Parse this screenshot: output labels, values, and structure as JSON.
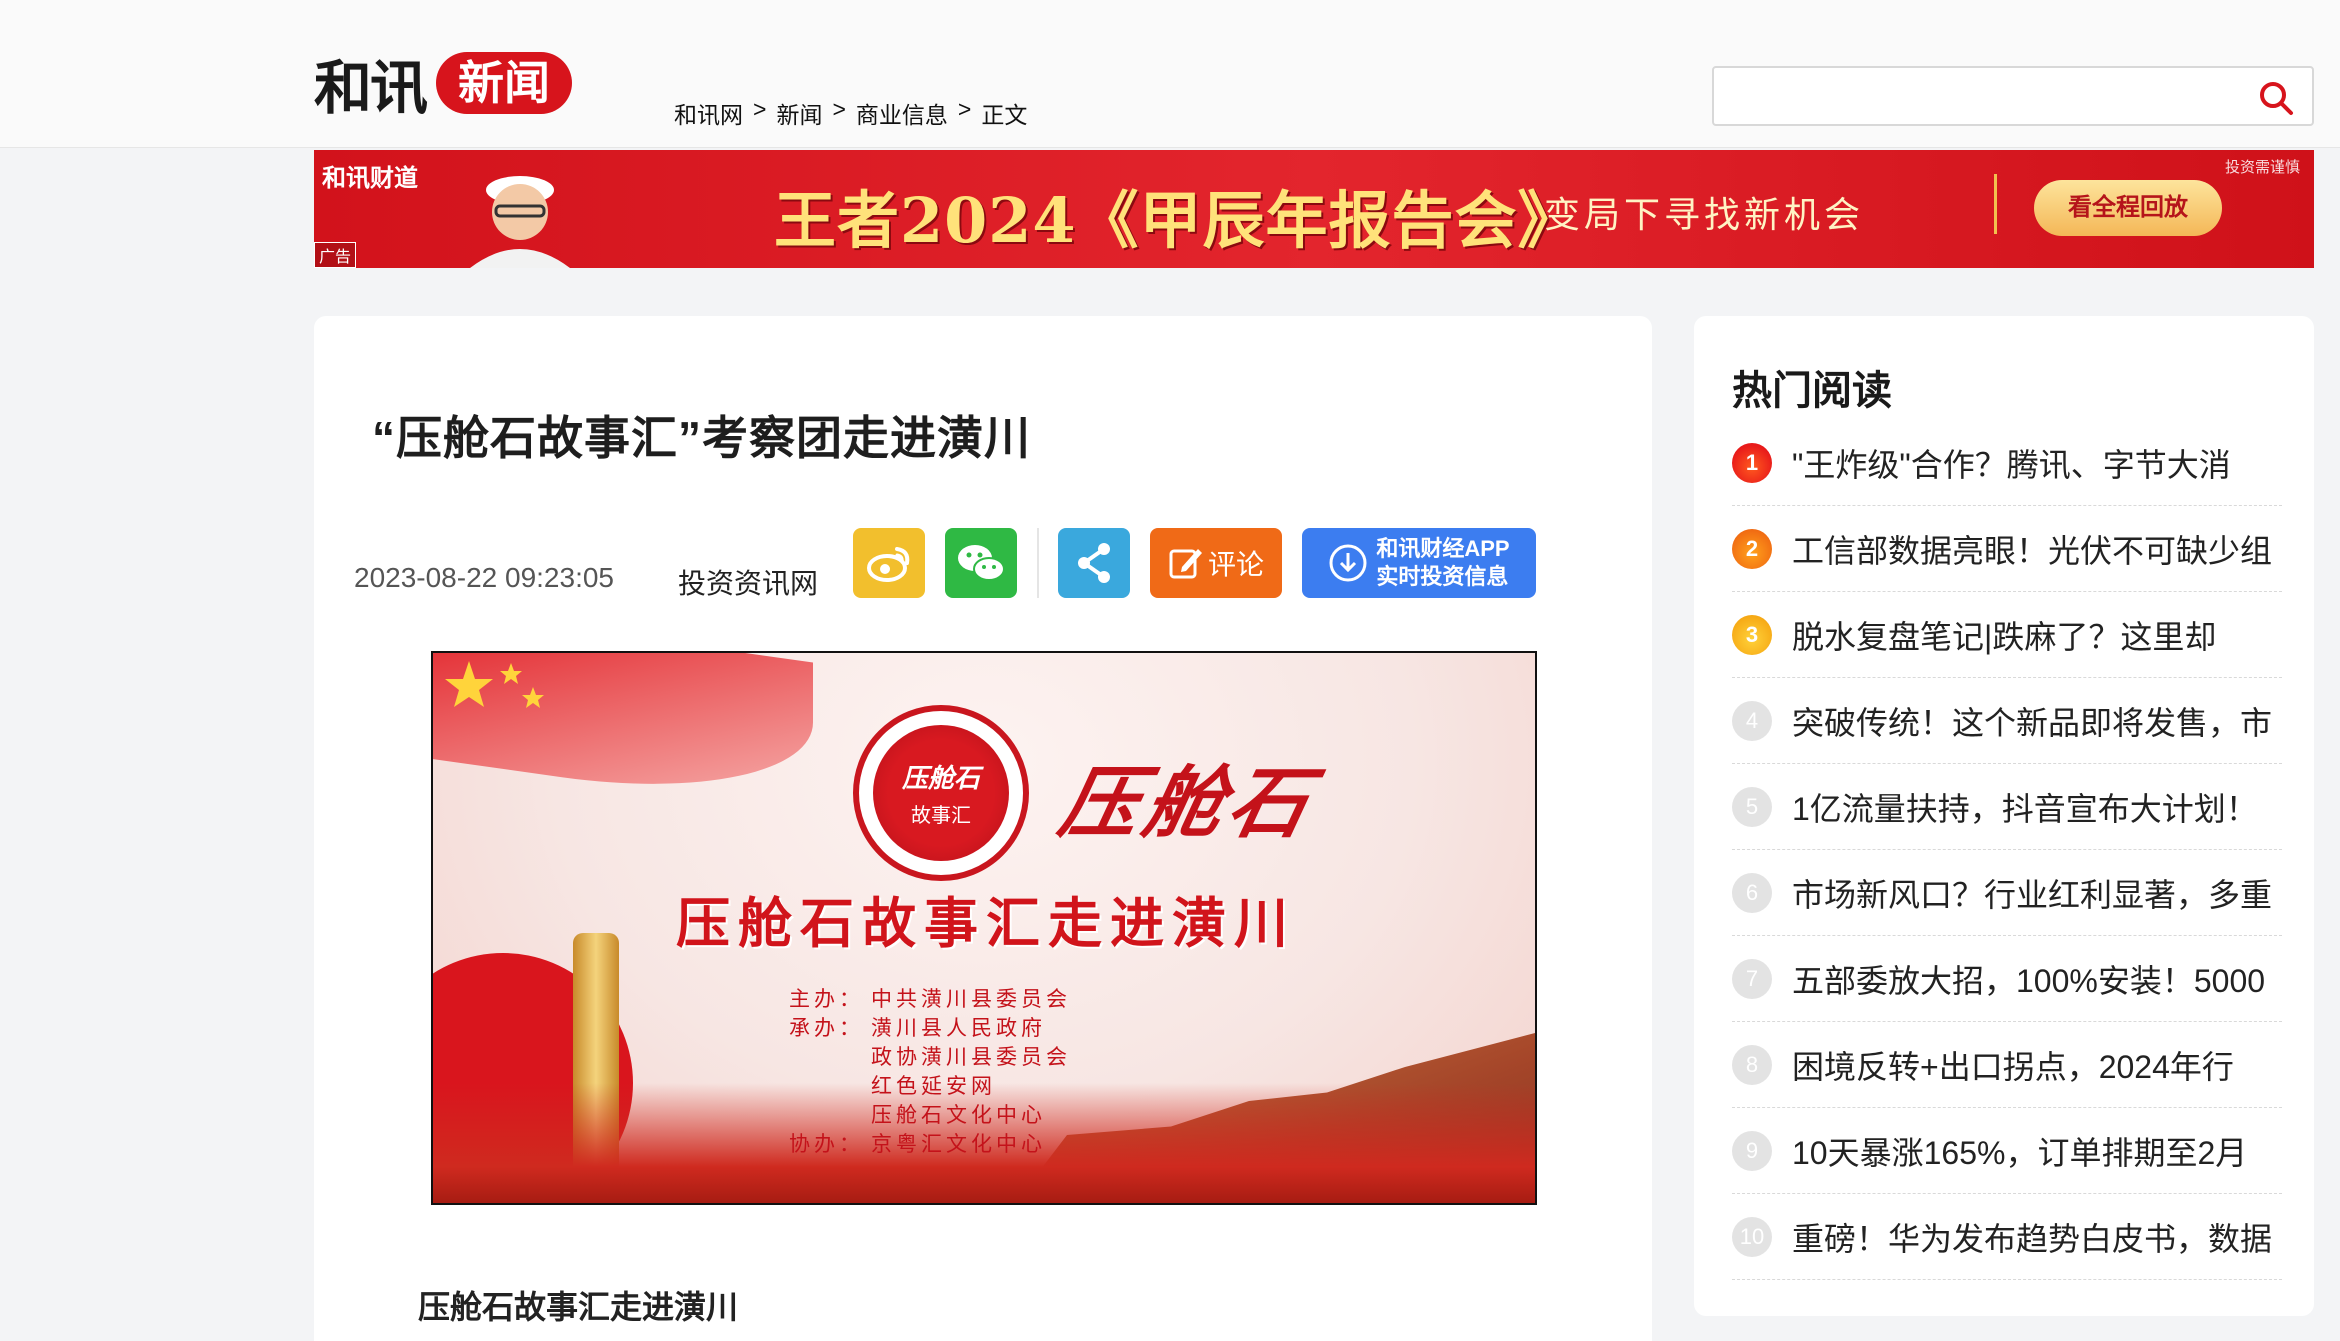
{
  "header": {
    "logo_main": "和讯",
    "logo_section": "新闻",
    "breadcrumb": [
      "和讯网",
      "新闻",
      "商业信息",
      "正文"
    ],
    "breadcrumb_sep": ">",
    "search_placeholder": ""
  },
  "banner": {
    "brand": "和讯财道",
    "ad_label": "广告",
    "title": "王者2024《甲辰年报告会》",
    "subtitle": "变局下寻找新机会",
    "button": "看全程回放",
    "note": "投资需谨慎"
  },
  "article": {
    "title": "“压舱石故事汇”考察团走进潢川",
    "date": "2023-08-22 09:23:05",
    "source": "投资资讯网",
    "share": {
      "comment": "评论",
      "app_line1": "和讯财经APP",
      "app_line2": "实时投资信息"
    },
    "figure": {
      "seal_top": "压舱石",
      "seal_bottom": "故事汇",
      "calligraphy": "压舱石",
      "headline": "压舱石故事汇走进潢川",
      "credits": [
        {
          "k": "主办：",
          "v": "中共潢川县委员会"
        },
        {
          "k": "承办：",
          "v": "潢川县人民政府"
        },
        {
          "k": "",
          "v": "政协潢川县委员会"
        },
        {
          "k": "",
          "v": "红色延安网"
        },
        {
          "k": "",
          "v": "压舱石文化中心"
        },
        {
          "k": "协办：",
          "v": "京粤汇文化中心"
        }
      ]
    },
    "subhead": "压舱石故事汇走进潢川"
  },
  "sidebar": {
    "title": "热门阅读",
    "items": [
      {
        "rank": "1",
        "text": "\"王炸级\"合作？腾讯、字节大消"
      },
      {
        "rank": "2",
        "text": "工信部数据亮眼！光伏不可缺少组"
      },
      {
        "rank": "3",
        "text": "脱水复盘笔记|跌麻了？这里却"
      },
      {
        "rank": "4",
        "text": "突破传统！这个新品即将发售，市"
      },
      {
        "rank": "5",
        "text": "1亿流量扶持，抖音宣布大计划！"
      },
      {
        "rank": "6",
        "text": "市场新风口？行业红利显著，多重"
      },
      {
        "rank": "7",
        "text": "五部委放大招，100%安装！5000"
      },
      {
        "rank": "8",
        "text": "困境反转+出口拐点，2024年行"
      },
      {
        "rank": "9",
        "text": "10天暴涨165%，订单排期至2月"
      },
      {
        "rank": "10",
        "text": "重磅！华为发布趋势白皮书，数据"
      }
    ]
  },
  "colors": {
    "brand_red": "#d7141c",
    "weibo": "#f2bf2d",
    "wechat": "#2fb944",
    "share": "#3aa8dd",
    "comment": "#f06a17",
    "app": "#3c7df0"
  }
}
